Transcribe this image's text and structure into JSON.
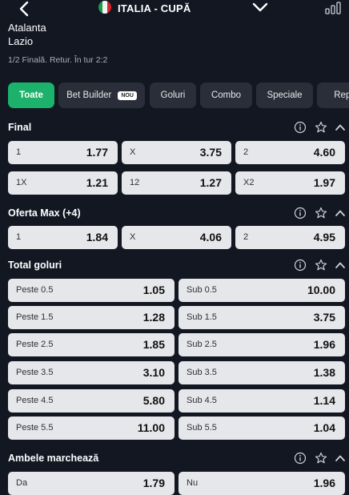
{
  "header": {
    "league": "ITALIA - CUPĂ"
  },
  "match": {
    "home": "Atalanta",
    "away": "Lazio",
    "info": "1/2 Finală. Retur. În tur 2:2"
  },
  "tabs": [
    {
      "label": "Toate",
      "active": true
    },
    {
      "label": "Bet Builder",
      "badge": "NOU"
    },
    {
      "label": "Goluri"
    },
    {
      "label": "Combo"
    },
    {
      "label": "Speciale"
    },
    {
      "label": "Repri"
    }
  ],
  "colors": {
    "background": "#121722",
    "accent": "#1cb26b",
    "cell": "#e6e7ea",
    "tab": "#2a2e38"
  },
  "icons": [
    "back-arrow-icon",
    "italy-flag-icon",
    "chevron-down-icon",
    "stats-bars-icon",
    "info-icon",
    "star-icon",
    "chevron-up-icon"
  ],
  "sections": {
    "final": {
      "title": "Final",
      "rows": [
        [
          {
            "label": "1",
            "odd": "1.77"
          },
          {
            "label": "X",
            "odd": "3.75"
          },
          {
            "label": "2",
            "odd": "4.60"
          }
        ],
        [
          {
            "label": "1X",
            "odd": "1.21"
          },
          {
            "label": "12",
            "odd": "1.27"
          },
          {
            "label": "X2",
            "odd": "1.97"
          }
        ]
      ]
    },
    "oferta": {
      "title": "Oferta Max (+4)",
      "rows": [
        [
          {
            "label": "1",
            "odd": "1.84"
          },
          {
            "label": "X",
            "odd": "4.06"
          },
          {
            "label": "2",
            "odd": "4.95"
          }
        ]
      ]
    },
    "total": {
      "title": "Total goluri",
      "rows": [
        [
          {
            "label": "Peste 0.5",
            "odd": "1.05"
          },
          {
            "label": "Sub 0.5",
            "odd": "10.00"
          }
        ],
        [
          {
            "label": "Peste 1.5",
            "odd": "1.28"
          },
          {
            "label": "Sub 1.5",
            "odd": "3.75"
          }
        ],
        [
          {
            "label": "Peste 2.5",
            "odd": "1.85"
          },
          {
            "label": "Sub 2.5",
            "odd": "1.96"
          }
        ],
        [
          {
            "label": "Peste 3.5",
            "odd": "3.10"
          },
          {
            "label": "Sub 3.5",
            "odd": "1.38"
          }
        ],
        [
          {
            "label": "Peste 4.5",
            "odd": "5.80"
          },
          {
            "label": "Sub 4.5",
            "odd": "1.14"
          }
        ],
        [
          {
            "label": "Peste 5.5",
            "odd": "11.00"
          },
          {
            "label": "Sub 5.5",
            "odd": "1.04"
          }
        ]
      ]
    },
    "ambele": {
      "title": "Ambele marchează",
      "rows": [
        [
          {
            "label": "Da",
            "odd": "1.79"
          },
          {
            "label": "Nu",
            "odd": "1.96"
          }
        ]
      ]
    }
  }
}
